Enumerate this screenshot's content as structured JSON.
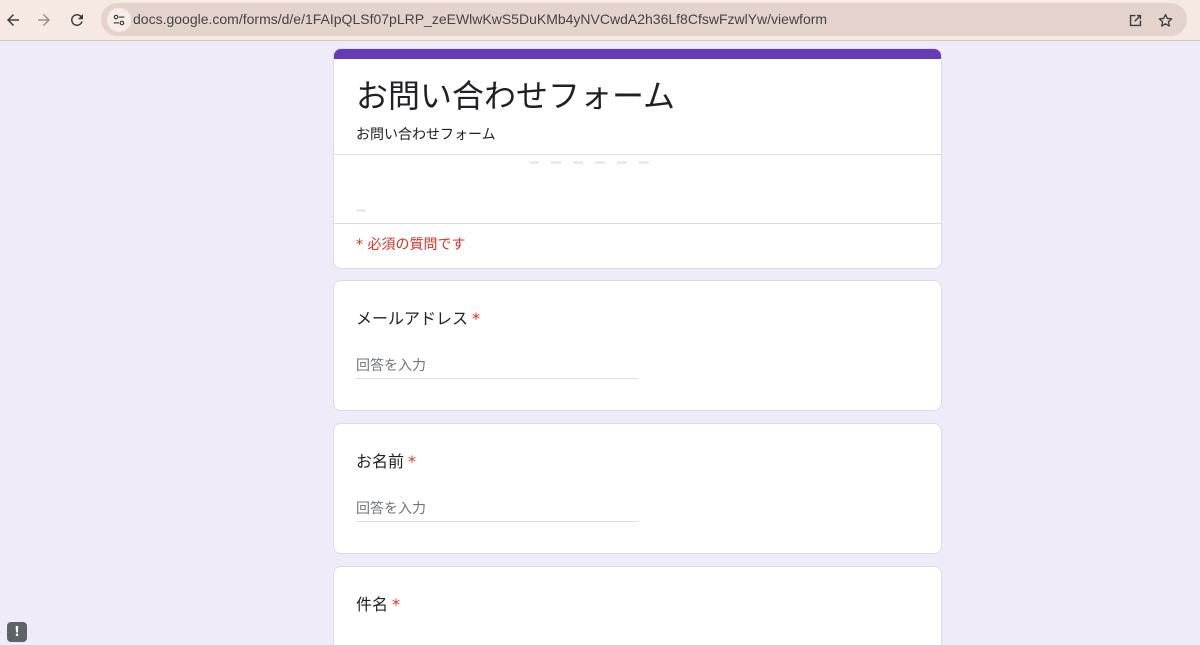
{
  "browser": {
    "url": "docs.google.com/forms/d/e/1FAIpQLSf07pLRP_zeEWlwKwS5DuKMb4yNVCwdA2h36Lf8CfswFzwlYw/viewform",
    "icons": [
      "back-icon",
      "forward-icon",
      "reload-icon",
      "site-info-icon",
      "share-icon",
      "star-icon"
    ]
  },
  "form": {
    "title": "お問い合わせフォーム",
    "description": "お問い合わせフォーム",
    "required_note": "* 必須の質問です",
    "accent_color": "#673ab7",
    "background_color": "#f0ebf8",
    "required_color": "#d93025",
    "questions": [
      {
        "label": "メールアドレス",
        "required_mark": "*",
        "placeholder": "回答を入力"
      },
      {
        "label": "お名前",
        "required_mark": "*",
        "placeholder": "回答を入力"
      },
      {
        "label": "件名",
        "required_mark": "*"
      }
    ]
  },
  "feedback": {
    "icon": "report-icon",
    "glyph": "!"
  }
}
